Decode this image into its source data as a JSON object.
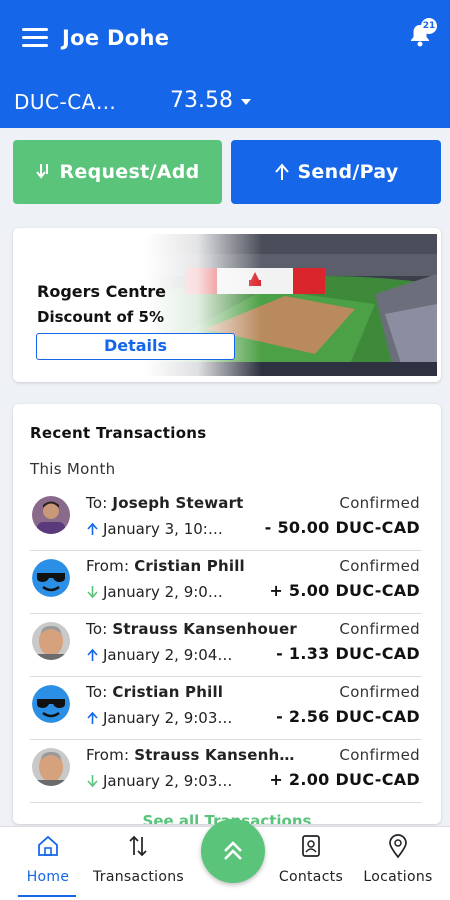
{
  "header": {
    "user_name": "Joe Dohe",
    "notification_count": "21",
    "currency": "DUC-CA…",
    "balance": "73.58"
  },
  "actions": {
    "request_label": "Request/Add",
    "send_label": "Send/Pay"
  },
  "promo": {
    "title": "Rogers Centre",
    "subtitle": "Discount of 5%",
    "details_label": "Details"
  },
  "transactions": {
    "heading": "Recent Transactions",
    "period": "This Month",
    "see_all": "See all Transactions",
    "items": [
      {
        "prefix": "To: ",
        "name": "Joseph Stewart",
        "date": "January 3, 10:…",
        "status": "Confirmed",
        "amount": "- 50.00 DUC-CAD"
      },
      {
        "prefix": "From: ",
        "name": "Cristian Phill",
        "date": "January 2, 9:0…",
        "status": "Confirmed",
        "amount": "+ 5.00 DUC-CAD"
      },
      {
        "prefix": "To: ",
        "name": "Strauss Kansenhouer",
        "date": "January 2, 9:04…",
        "status": "Confirmed",
        "amount": "- 1.33 DUC-CAD"
      },
      {
        "prefix": "To: ",
        "name": "Cristian Phill",
        "date": "January 2, 9:03…",
        "status": "Confirmed",
        "amount": "- 2.56 DUC-CAD"
      },
      {
        "prefix": "From: ",
        "name": "Strauss Kansenh…",
        "date": "January 2, 9:03…",
        "status": "Confirmed",
        "amount": "+ 2.00 DUC-CAD"
      }
    ]
  },
  "nav": {
    "home": "Home",
    "transactions": "Transactions",
    "contacts": "Contacts",
    "locations": "Locations"
  },
  "colors": {
    "brand_blue": "#1566e8",
    "accent_green": "#5ac47b"
  }
}
